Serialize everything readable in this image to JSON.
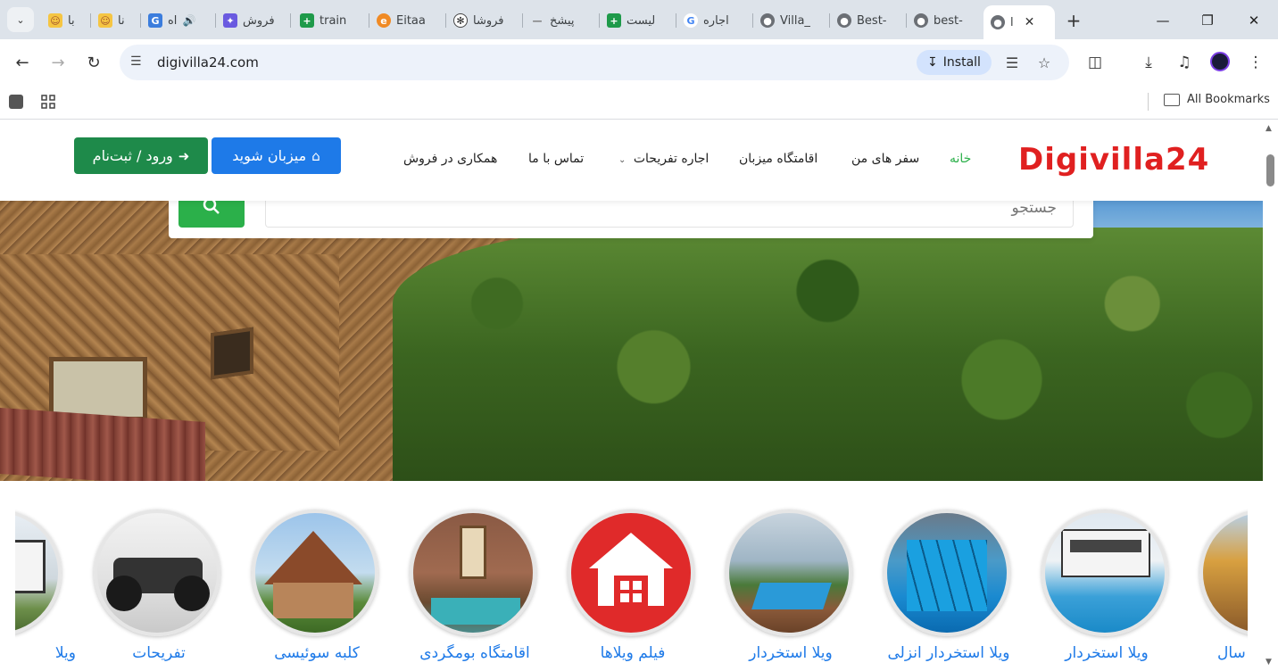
{
  "browser": {
    "tabs": [
      {
        "title": "با",
        "favicon": "emoji"
      },
      {
        "title": "نا",
        "favicon": "emoji"
      },
      {
        "title": "اه",
        "favicon": "g-blue"
      },
      {
        "title": "فروش",
        "favicon": "bird"
      },
      {
        "title": "train",
        "favicon": "plus-green"
      },
      {
        "title": "Eitaa",
        "favicon": "eitaa"
      },
      {
        "title": "فروشا",
        "favicon": "openai"
      },
      {
        "title": "پیشخ",
        "favicon": "dash"
      },
      {
        "title": "لیست",
        "favicon": "plus-green"
      },
      {
        "title": "اجاره",
        "favicon": "google"
      },
      {
        "title": "Villa_",
        "favicon": "globe"
      },
      {
        "title": "Best-",
        "favicon": "globe"
      },
      {
        "title": "best-",
        "favicon": "globe"
      },
      {
        "title": "ا",
        "favicon": "globe",
        "active": true
      }
    ],
    "url": "digivilla24.com",
    "install_label": "Install",
    "all_bookmarks_label": "All Bookmarks"
  },
  "site": {
    "logo": "Digivilla24",
    "nav": {
      "home": "خانه",
      "my_trips": "سفر های من",
      "host_stay": "اقامتگاه میزبان",
      "rent_fun": "اجاره تفریحات",
      "contact": "تماس با ما",
      "sales": "همکاری در فروش"
    },
    "host_button": "میزبان شوید",
    "login_button": "ورود / ثبت‌نام",
    "search_placeholder": "جستجو"
  },
  "categories": [
    {
      "label": "ویلا"
    },
    {
      "label": "تفریحات"
    },
    {
      "label": "کلبه سوئیسی"
    },
    {
      "label": "اقامتگاه بومگردی"
    },
    {
      "label": "فیلم ویلاها"
    },
    {
      "label": "ویلا استخردار"
    },
    {
      "label": "ویلا استخردار انزلی"
    },
    {
      "label": "ویلا استخردار"
    },
    {
      "label": "سال"
    }
  ],
  "colors": {
    "brand_red": "#e02020",
    "nav_active": "#2bb04a",
    "host_button": "#1e7ae8",
    "login_button": "#1e8a4a",
    "link_blue": "#1e7ae8"
  }
}
